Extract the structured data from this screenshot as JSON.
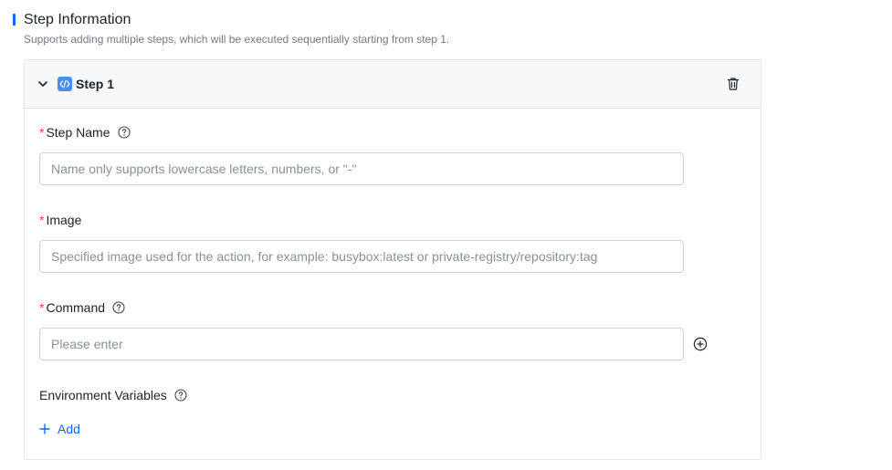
{
  "section": {
    "title": "Step Information",
    "description": "Supports adding multiple steps, which will be executed sequentially starting from step 1."
  },
  "step": {
    "title": "Step 1",
    "fields": {
      "name": {
        "label": "Step Name",
        "value": "",
        "placeholder": "Name only supports lowercase letters, numbers, or \"-\""
      },
      "image": {
        "label": "Image",
        "value": "",
        "placeholder": "Specified image used for the action, for example: busybox:latest or private-registry/repository:tag"
      },
      "command": {
        "label": "Command",
        "value": "",
        "placeholder": "Please enter"
      },
      "env": {
        "label": "Environment Variables",
        "add_label": "Add"
      }
    },
    "required_mark": "*"
  },
  "colors": {
    "accent": "#1664ff",
    "required": "#e63f3f",
    "step_icon": "#4a8bf5"
  },
  "icons": [
    "chevron-down-icon",
    "code-icon",
    "trash-icon",
    "help-icon",
    "plus-circle-icon",
    "plus-icon"
  ]
}
